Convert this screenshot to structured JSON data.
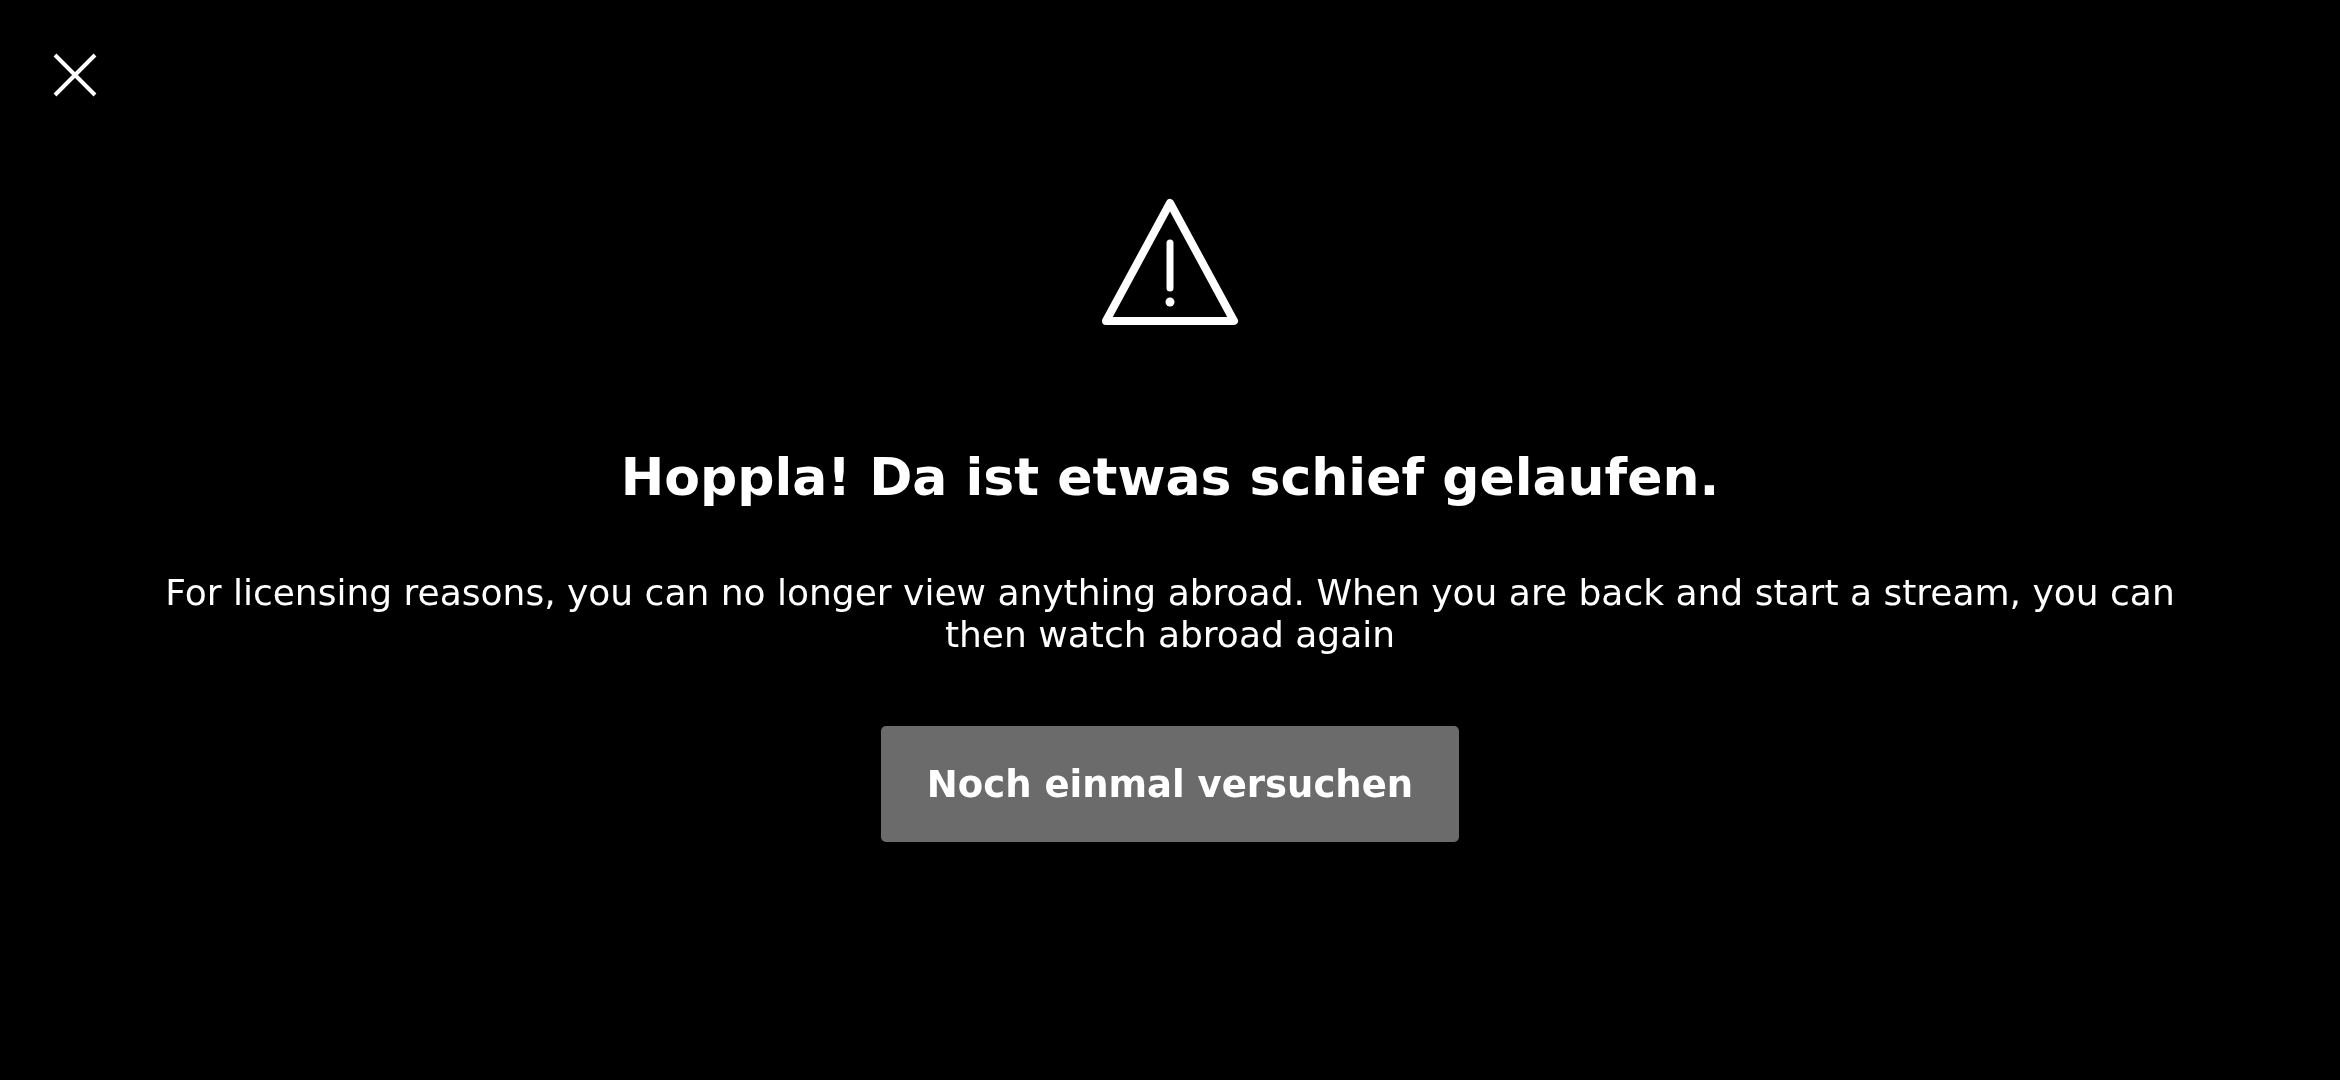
{
  "dialog": {
    "title": "Hoppla! Da ist etwas schief gelaufen.",
    "message": "For licensing reasons, you can no longer view anything abroad. When you are back and start a stream, you can then watch abroad again",
    "buttons": [
      "Noch einmal versuchen"
    ]
  }
}
